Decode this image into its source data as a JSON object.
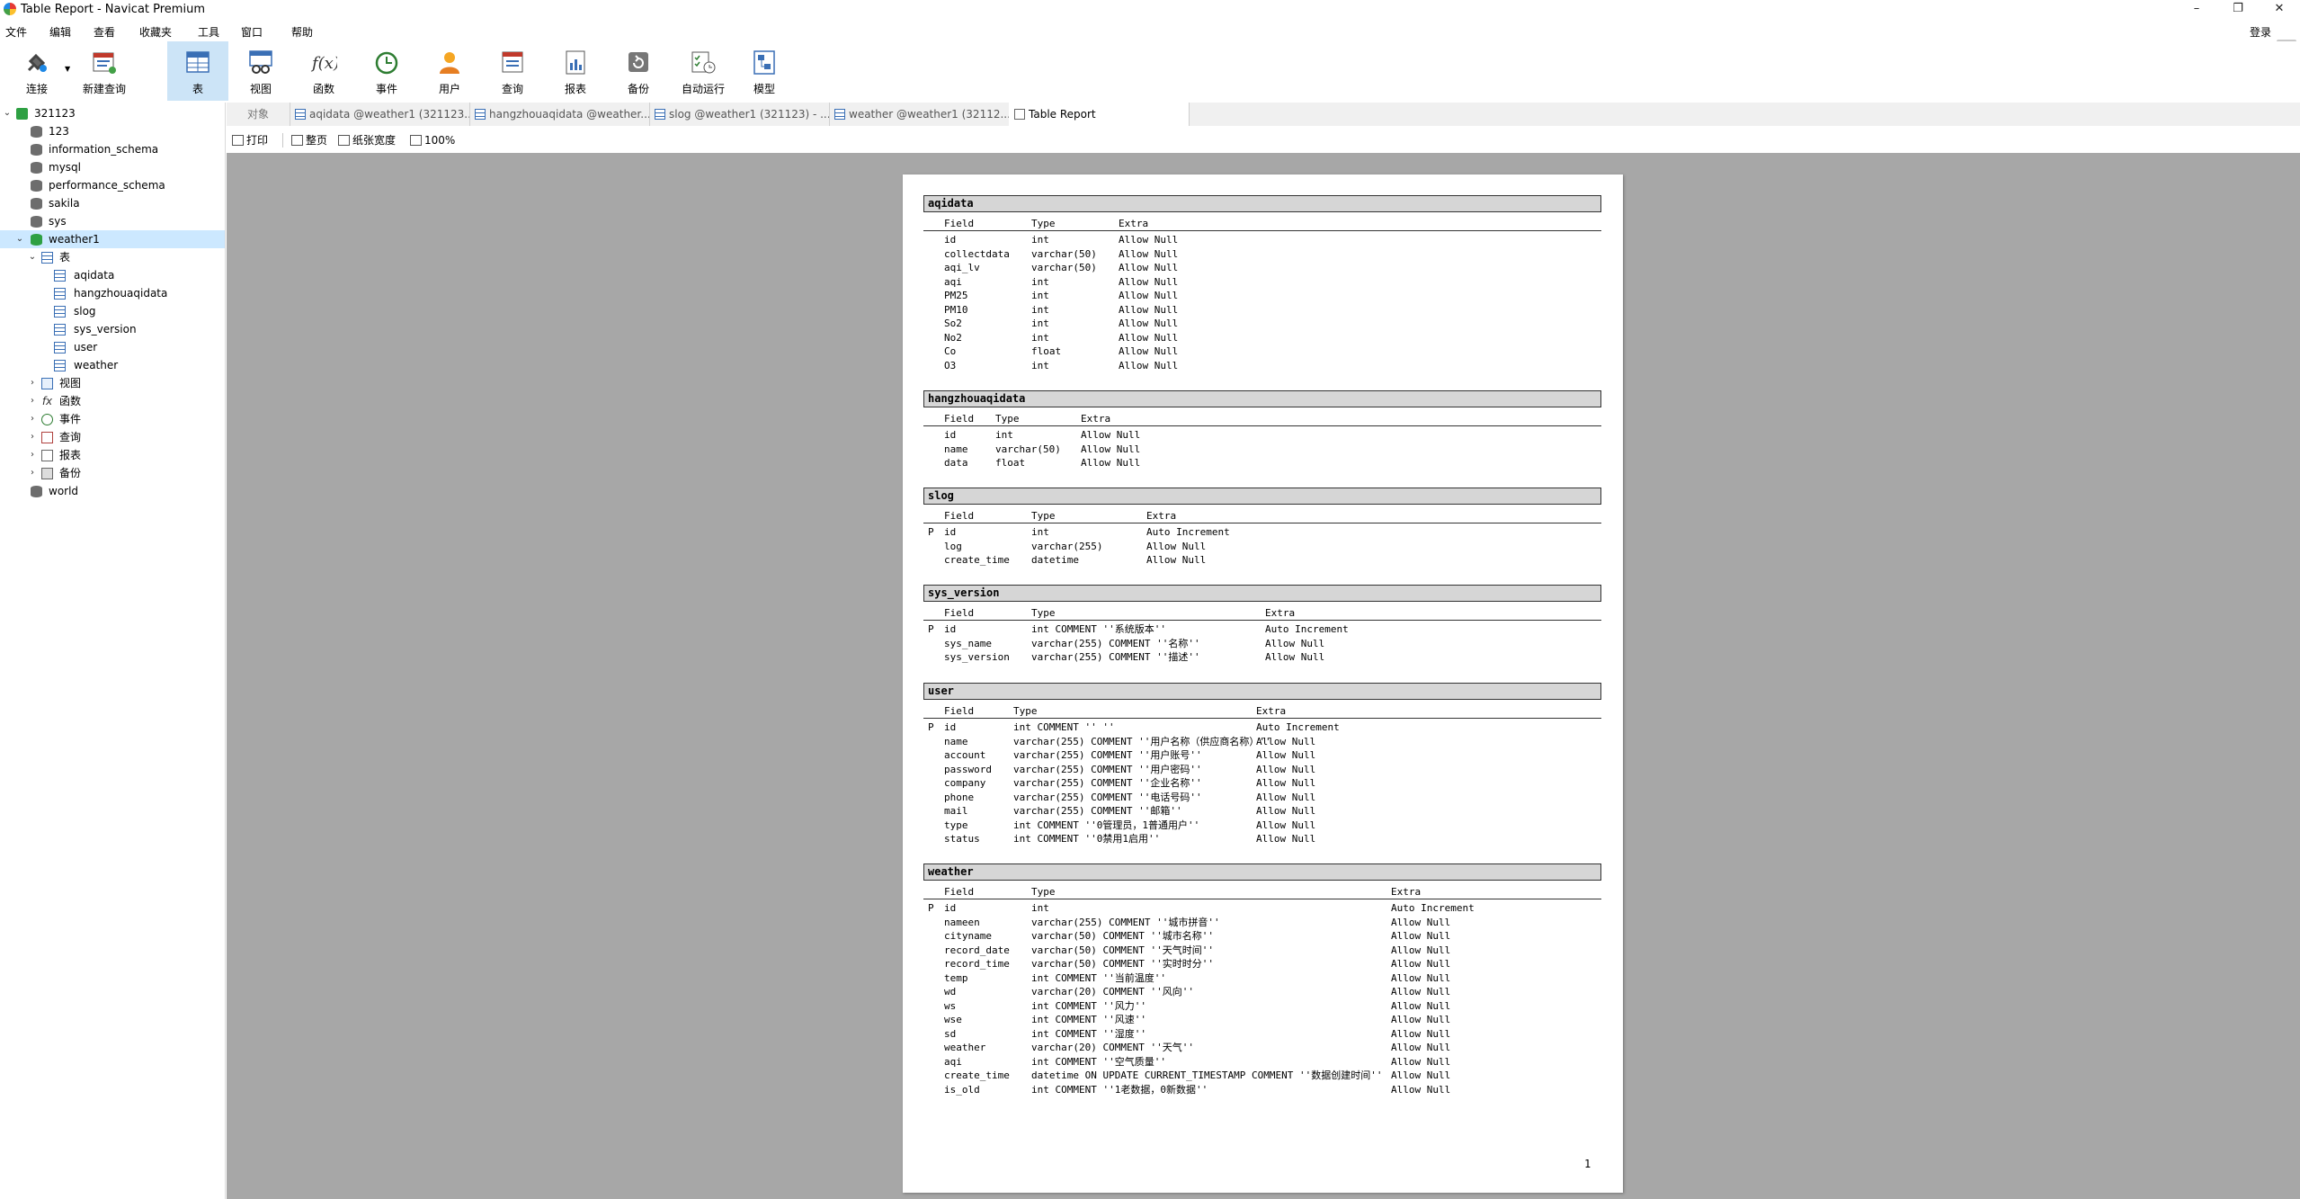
{
  "window": {
    "title": "Table Report - Navicat Premium",
    "controls": [
      "–",
      "❐",
      "✕"
    ]
  },
  "menu": {
    "items": [
      "文件",
      "编辑",
      "查看",
      "收藏夹",
      "工具",
      "窗口",
      "帮助"
    ],
    "login": "登录"
  },
  "toolbar": {
    "buttons": [
      {
        "label": "连接",
        "icon": "plug-icon"
      },
      {
        "label": "新建查询",
        "icon": "new-query-icon"
      },
      {
        "label": "表",
        "icon": "table-icon"
      },
      {
        "label": "视图",
        "icon": "view-icon"
      },
      {
        "label": "函数",
        "icon": "function-icon"
      },
      {
        "label": "事件",
        "icon": "event-clock-icon"
      },
      {
        "label": "用户",
        "icon": "user-icon"
      },
      {
        "label": "查询",
        "icon": "query-icon"
      },
      {
        "label": "报表",
        "icon": "report-icon"
      },
      {
        "label": "备份",
        "icon": "backup-icon"
      },
      {
        "label": "自动运行",
        "icon": "automation-icon"
      },
      {
        "label": "模型",
        "icon": "model-icon"
      }
    ],
    "active": "表"
  },
  "sidebar": {
    "items": [
      {
        "label": "321123",
        "kind": "connection",
        "expanded": true
      },
      {
        "label": "123",
        "kind": "database"
      },
      {
        "label": "information_schema",
        "kind": "database"
      },
      {
        "label": "mysql",
        "kind": "database"
      },
      {
        "label": "performance_schema",
        "kind": "database"
      },
      {
        "label": "sakila",
        "kind": "database"
      },
      {
        "label": "sys",
        "kind": "database"
      },
      {
        "label": "weather1",
        "kind": "database-open",
        "expanded": true,
        "selected": true
      },
      {
        "label": "表",
        "kind": "tables-folder",
        "expanded": true
      },
      {
        "label": "aqidata",
        "kind": "table"
      },
      {
        "label": "hangzhouaqidata",
        "kind": "table"
      },
      {
        "label": "slog",
        "kind": "table"
      },
      {
        "label": "sys_version",
        "kind": "table"
      },
      {
        "label": "user",
        "kind": "table"
      },
      {
        "label": "weather",
        "kind": "table"
      },
      {
        "label": "视图",
        "kind": "views-folder",
        "expanded": false
      },
      {
        "label": "函数",
        "kind": "functions-folder",
        "expanded": false
      },
      {
        "label": "事件",
        "kind": "events-folder",
        "expanded": false
      },
      {
        "label": "查询",
        "kind": "queries-folder",
        "expanded": false
      },
      {
        "label": "报表",
        "kind": "reports-folder",
        "expanded": false
      },
      {
        "label": "备份",
        "kind": "backups-folder",
        "expanded": false
      },
      {
        "label": "world",
        "kind": "database"
      }
    ]
  },
  "tabs": [
    {
      "label": "对象",
      "kind": "objects"
    },
    {
      "label": "aqidata @weather1 (321123...",
      "kind": "table"
    },
    {
      "label": "hangzhouaqidata @weather...",
      "kind": "table"
    },
    {
      "label": "slog @weather1 (321123) - ...",
      "kind": "table"
    },
    {
      "label": "weather @weather1 (32112...",
      "kind": "table"
    },
    {
      "label": "Table Report",
      "kind": "report",
      "active": true
    }
  ],
  "printbar": {
    "print": "打印",
    "whole_page": "整页",
    "page_width": "纸张宽度",
    "zoom": "100%"
  },
  "report": {
    "page_number": "1",
    "header": {
      "field": "Field",
      "type": "Type",
      "extra": "Extra"
    },
    "tables": [
      {
        "name": "aqidata",
        "rows": [
          {
            "key": "",
            "field": "id",
            "type": "int",
            "extra": "Allow Null"
          },
          {
            "key": "",
            "field": "collectdata",
            "type": "varchar(50)",
            "extra": "Allow Null"
          },
          {
            "key": "",
            "field": "aqi_lv",
            "type": "varchar(50)",
            "extra": "Allow Null"
          },
          {
            "key": "",
            "field": "aqi",
            "type": "int",
            "extra": "Allow Null"
          },
          {
            "key": "",
            "field": "PM25",
            "type": "int",
            "extra": "Allow Null"
          },
          {
            "key": "",
            "field": "PM10",
            "type": "int",
            "extra": "Allow Null"
          },
          {
            "key": "",
            "field": "So2",
            "type": "int",
            "extra": "Allow Null"
          },
          {
            "key": "",
            "field": "No2",
            "type": "int",
            "extra": "Allow Null"
          },
          {
            "key": "",
            "field": "Co",
            "type": "float",
            "extra": "Allow Null"
          },
          {
            "key": "",
            "field": "O3",
            "type": "int",
            "extra": "Allow Null"
          }
        ]
      },
      {
        "name": "hangzhouaqidata",
        "rows": [
          {
            "key": "",
            "field": "id",
            "type": "int",
            "extra": "Allow Null"
          },
          {
            "key": "",
            "field": "name",
            "type": "varchar(50)",
            "extra": "Allow Null"
          },
          {
            "key": "",
            "field": "data",
            "type": "float",
            "extra": "Allow Null"
          }
        ]
      },
      {
        "name": "slog",
        "rows": [
          {
            "key": "P",
            "field": "id",
            "type": "int",
            "extra": "Auto Increment"
          },
          {
            "key": "",
            "field": "log",
            "type": "varchar(255)",
            "extra": "Allow Null"
          },
          {
            "key": "",
            "field": "create_time",
            "type": "datetime",
            "extra": "Allow Null"
          }
        ]
      },
      {
        "name": "sys_version",
        "rows": [
          {
            "key": "P",
            "field": "id",
            "type": "int COMMENT ''系统版本''",
            "extra": "Auto Increment"
          },
          {
            "key": "",
            "field": "sys_name",
            "type": "varchar(255) COMMENT ''名称''",
            "extra": "Allow Null"
          },
          {
            "key": "",
            "field": "sys_version",
            "type": "varchar(255) COMMENT ''描述''",
            "extra": "Allow Null"
          }
        ]
      },
      {
        "name": "user",
        "rows": [
          {
            "key": "P",
            "field": "id",
            "type": "int COMMENT '' ''",
            "extra": "Auto Increment"
          },
          {
            "key": "",
            "field": "name",
            "type": "varchar(255) COMMENT ''用户名称（供应商名称）''",
            "extra": "Allow Null"
          },
          {
            "key": "",
            "field": "account",
            "type": "varchar(255) COMMENT ''用户账号''",
            "extra": "Allow Null"
          },
          {
            "key": "",
            "field": "password",
            "type": "varchar(255) COMMENT ''用户密码''",
            "extra": "Allow Null"
          },
          {
            "key": "",
            "field": "company",
            "type": "varchar(255) COMMENT ''企业名称''",
            "extra": "Allow Null"
          },
          {
            "key": "",
            "field": "phone",
            "type": "varchar(255) COMMENT ''电话号码''",
            "extra": "Allow Null"
          },
          {
            "key": "",
            "field": "mail",
            "type": "varchar(255) COMMENT ''邮箱''",
            "extra": "Allow Null"
          },
          {
            "key": "",
            "field": "type",
            "type": "int COMMENT ''0管理员，1普通用户''",
            "extra": "Allow Null"
          },
          {
            "key": "",
            "field": "status",
            "type": "int COMMENT ''0禁用1启用''",
            "extra": "Allow Null"
          }
        ]
      },
      {
        "name": "weather",
        "rows": [
          {
            "key": "P",
            "field": "id",
            "type": "int",
            "extra": "Auto Increment"
          },
          {
            "key": "",
            "field": "nameen",
            "type": "varchar(255) COMMENT ''城市拼音''",
            "extra": "Allow Null"
          },
          {
            "key": "",
            "field": "cityname",
            "type": "varchar(50) COMMENT ''城市名称''",
            "extra": "Allow Null"
          },
          {
            "key": "",
            "field": "record_date",
            "type": "varchar(50) COMMENT ''天气时间''",
            "extra": "Allow Null"
          },
          {
            "key": "",
            "field": "record_time",
            "type": "varchar(50) COMMENT ''实时时分''",
            "extra": "Allow Null"
          },
          {
            "key": "",
            "field": "temp",
            "type": "int COMMENT ''当前温度''",
            "extra": "Allow Null"
          },
          {
            "key": "",
            "field": "wd",
            "type": "varchar(20) COMMENT ''风向''",
            "extra": "Allow Null"
          },
          {
            "key": "",
            "field": "ws",
            "type": "int COMMENT ''风力''",
            "extra": "Allow Null"
          },
          {
            "key": "",
            "field": "wse",
            "type": "int COMMENT ''风速''",
            "extra": "Allow Null"
          },
          {
            "key": "",
            "field": "sd",
            "type": "int COMMENT ''湿度''",
            "extra": "Allow Null"
          },
          {
            "key": "",
            "field": "weather",
            "type": "varchar(20) COMMENT ''天气''",
            "extra": "Allow Null"
          },
          {
            "key": "",
            "field": "aqi",
            "type": "int COMMENT ''空气质量''",
            "extra": "Allow Null"
          },
          {
            "key": "",
            "field": "create_time",
            "type": "datetime ON UPDATE CURRENT_TIMESTAMP COMMENT ''数据创建时间''",
            "extra": "Allow Null"
          },
          {
            "key": "",
            "field": "is_old",
            "type": "int COMMENT ''1老数据，0新数据''",
            "extra": "Allow Null"
          }
        ]
      }
    ]
  }
}
